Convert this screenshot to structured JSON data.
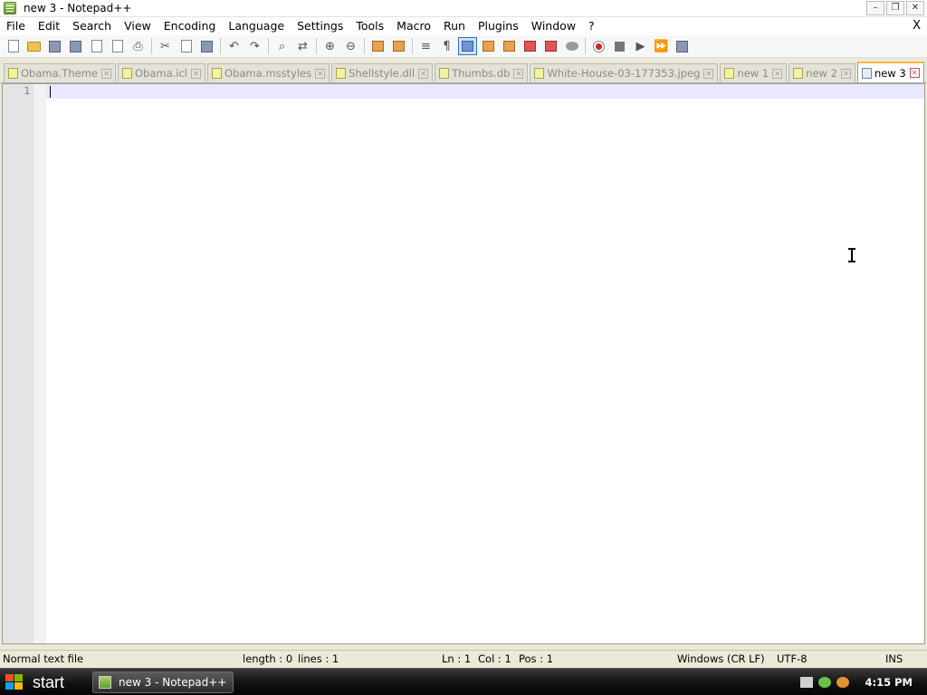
{
  "window": {
    "title": "new 3 - Notepad++",
    "controls": {
      "minimize": "–",
      "restore": "❐",
      "close": "✕"
    }
  },
  "menu": {
    "items": [
      "File",
      "Edit",
      "Search",
      "View",
      "Encoding",
      "Language",
      "Settings",
      "Tools",
      "Macro",
      "Run",
      "Plugins",
      "Window",
      "?"
    ],
    "close_label": "X"
  },
  "toolbar": {
    "icons": [
      "new-file-icon",
      "open-file-icon",
      "save-icon",
      "save-all-icon",
      "close-icon",
      "close-all-icon",
      "print-icon",
      "cut-icon",
      "copy-icon",
      "paste-icon",
      "undo-icon",
      "redo-icon",
      "find-icon",
      "replace-icon",
      "zoom-in-icon",
      "zoom-out-icon",
      "sync-vertical-icon",
      "sync-horizontal-icon",
      "word-wrap-icon",
      "show-all-chars-icon",
      "indent-guide-icon",
      "user-language-icon",
      "doc-map-icon",
      "function-list-icon",
      "folder-workspace-icon",
      "monitoring-icon",
      "record-macro-icon",
      "stop-macro-icon",
      "play-macro-icon",
      "run-macro-multiple-icon",
      "save-macro-icon"
    ],
    "active_icon": "indent-guide-icon"
  },
  "tabs": [
    {
      "label": "Obama.Theme",
      "active": false
    },
    {
      "label": "Obama.icl",
      "active": false
    },
    {
      "label": "Obama.msstyles",
      "active": false
    },
    {
      "label": "Shellstyle.dll",
      "active": false
    },
    {
      "label": "Thumbs.db",
      "active": false
    },
    {
      "label": "White-House-03-177353.jpeg",
      "active": false
    },
    {
      "label": "new 1",
      "active": false
    },
    {
      "label": "new 2",
      "active": false
    },
    {
      "label": "new 3",
      "active": true
    }
  ],
  "editor": {
    "line_numbers": [
      "1"
    ],
    "content": ""
  },
  "statusbar": {
    "file_type": "Normal text file",
    "length": "length : 0",
    "lines": "lines : 1",
    "ln": "Ln : 1",
    "col": "Col : 1",
    "pos": "Pos : 1",
    "eol": "Windows (CR LF)",
    "encoding": "UTF-8",
    "mode": "INS"
  },
  "taskbar": {
    "start_label": "start",
    "task_label": "new 3 - Notepad++",
    "clock": "4:15 PM"
  },
  "colors": {
    "active_tab_accent": "#fab73c",
    "current_line": "#e8e8ff",
    "taskbar": "#111111"
  }
}
